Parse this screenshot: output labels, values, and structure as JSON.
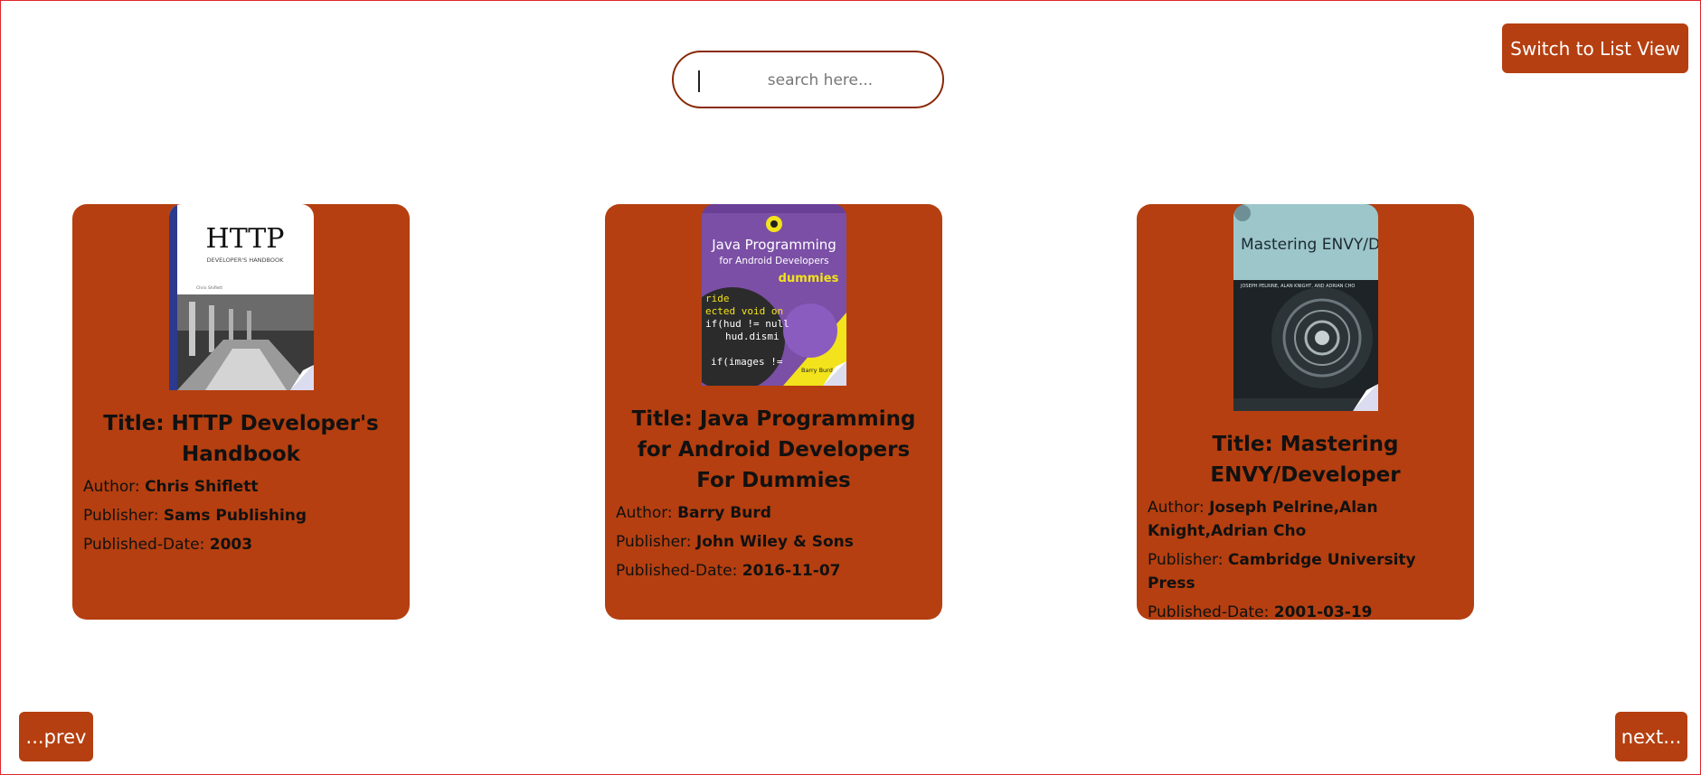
{
  "search": {
    "placeholder": "search here..."
  },
  "header": {
    "switch_view_label": "Switch to List View"
  },
  "pagination": {
    "prev_label": "...prev",
    "next_label": "next..."
  },
  "colors": {
    "accent": "#b53f10",
    "search_border": "#8a2a0a",
    "frame_border": "#e0242e"
  },
  "labels": {
    "author": "Author:",
    "publisher": "Publisher:",
    "published_date": "Published-Date:"
  },
  "books": [
    {
      "title": "Title: HTTP Developer's Handbook",
      "author": "Chris Shiflett",
      "publisher": "Sams Publishing",
      "published_date": "2003",
      "cover": {
        "heading": "HTTP",
        "subheading": "DEVELOPER'S HANDBOOK",
        "byline": "Chris Shiflett"
      }
    },
    {
      "title": "Title: Java Programming for Android Developers For Dummies",
      "author": "Barry Burd",
      "publisher": "John Wiley & Sons",
      "published_date": "2016-11-07",
      "cover": {
        "heading": "Java Programming",
        "subheading": "for Android Developers",
        "brand": "dummies",
        "byline": "Barry Burd, PhD"
      }
    },
    {
      "title": "Title: Mastering ENVY/Developer",
      "author": "Joseph Pelrine,Alan Knight,Adrian Cho",
      "publisher": "Cambridge University Press",
      "published_date": "2001-03-19",
      "cover": {
        "heading": "Mastering ENVY/Developer",
        "byline": "JOSEPH PELRINE, ALAN KNIGHT, AND ADRIAN CHO"
      }
    }
  ]
}
